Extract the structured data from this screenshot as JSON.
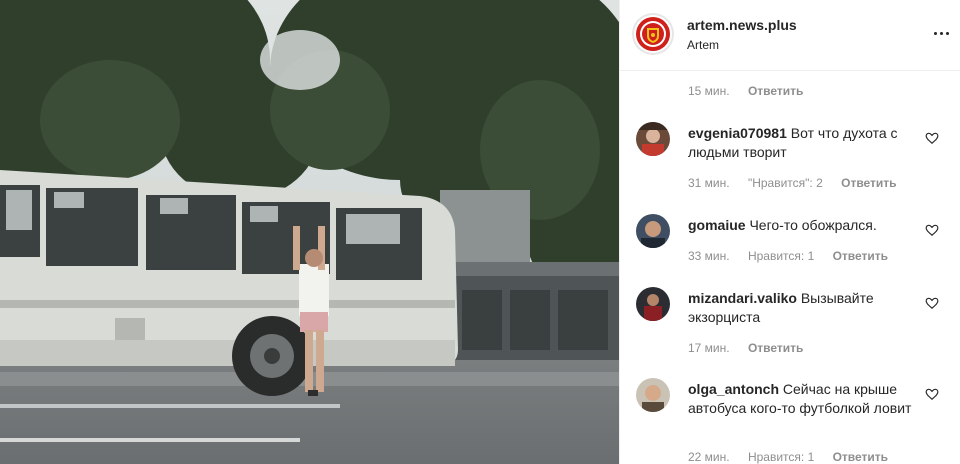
{
  "post": {
    "username": "artem.news.plus",
    "location": "Artem",
    "more_icon": "more-horizontal-icon"
  },
  "top_meta": {
    "time": "15 мин.",
    "reply": "Ответить"
  },
  "comments": [
    {
      "author": "evgenia070981",
      "text": "Вот что духота с людьми творит",
      "time": "31 мин.",
      "likes": "\"Нравится\": 2",
      "reply": "Ответить"
    },
    {
      "author": "gomaiue",
      "text": "Чего-то обожрался.",
      "time": "33 мин.",
      "likes": "Нравится: 1",
      "reply": "Ответить"
    },
    {
      "author": "mizandari.valiko",
      "text": "Вызывайте экзорциста",
      "time": "17 мин.",
      "likes": "",
      "reply": "Ответить"
    },
    {
      "author": "olga_antonch",
      "text": "Сейчас на крыше автобуса кого-то футболкой ловит",
      "time": "22 мин.",
      "likes": "Нравится: 1",
      "reply": "Ответить"
    }
  ],
  "colors": {
    "text": "#262626",
    "secondary": "#8e8e8e",
    "divider": "#efefef",
    "logo_red": "#d0201c",
    "logo_yellow": "#f0c419"
  }
}
